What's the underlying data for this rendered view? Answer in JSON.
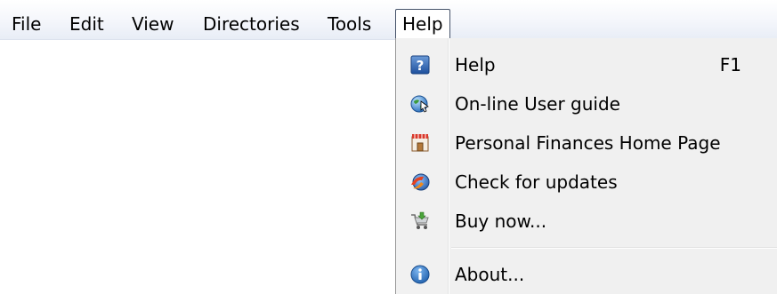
{
  "menubar": {
    "items": [
      {
        "label": "File"
      },
      {
        "label": "Edit"
      },
      {
        "label": "View"
      },
      {
        "label": "Directories"
      },
      {
        "label": "Tools"
      },
      {
        "label": "Help",
        "open": true
      }
    ]
  },
  "help_menu": {
    "items": [
      {
        "label": "Help",
        "shortcut": "F1",
        "icon": "help-question-icon"
      },
      {
        "label": "On-line User guide",
        "icon": "globe-cursor-icon"
      },
      {
        "label": "Personal Finances Home Page",
        "icon": "home-page-icon"
      },
      {
        "label": "Check for updates",
        "icon": "update-icon"
      },
      {
        "label": "Buy now...",
        "icon": "shopping-cart-icon"
      },
      {
        "label": "About...",
        "icon": "info-icon"
      }
    ]
  },
  "colors": {
    "menu_background": "#f0f0f0",
    "open_menu_border": "#46536a",
    "info_blue": "#1f6fc0"
  }
}
